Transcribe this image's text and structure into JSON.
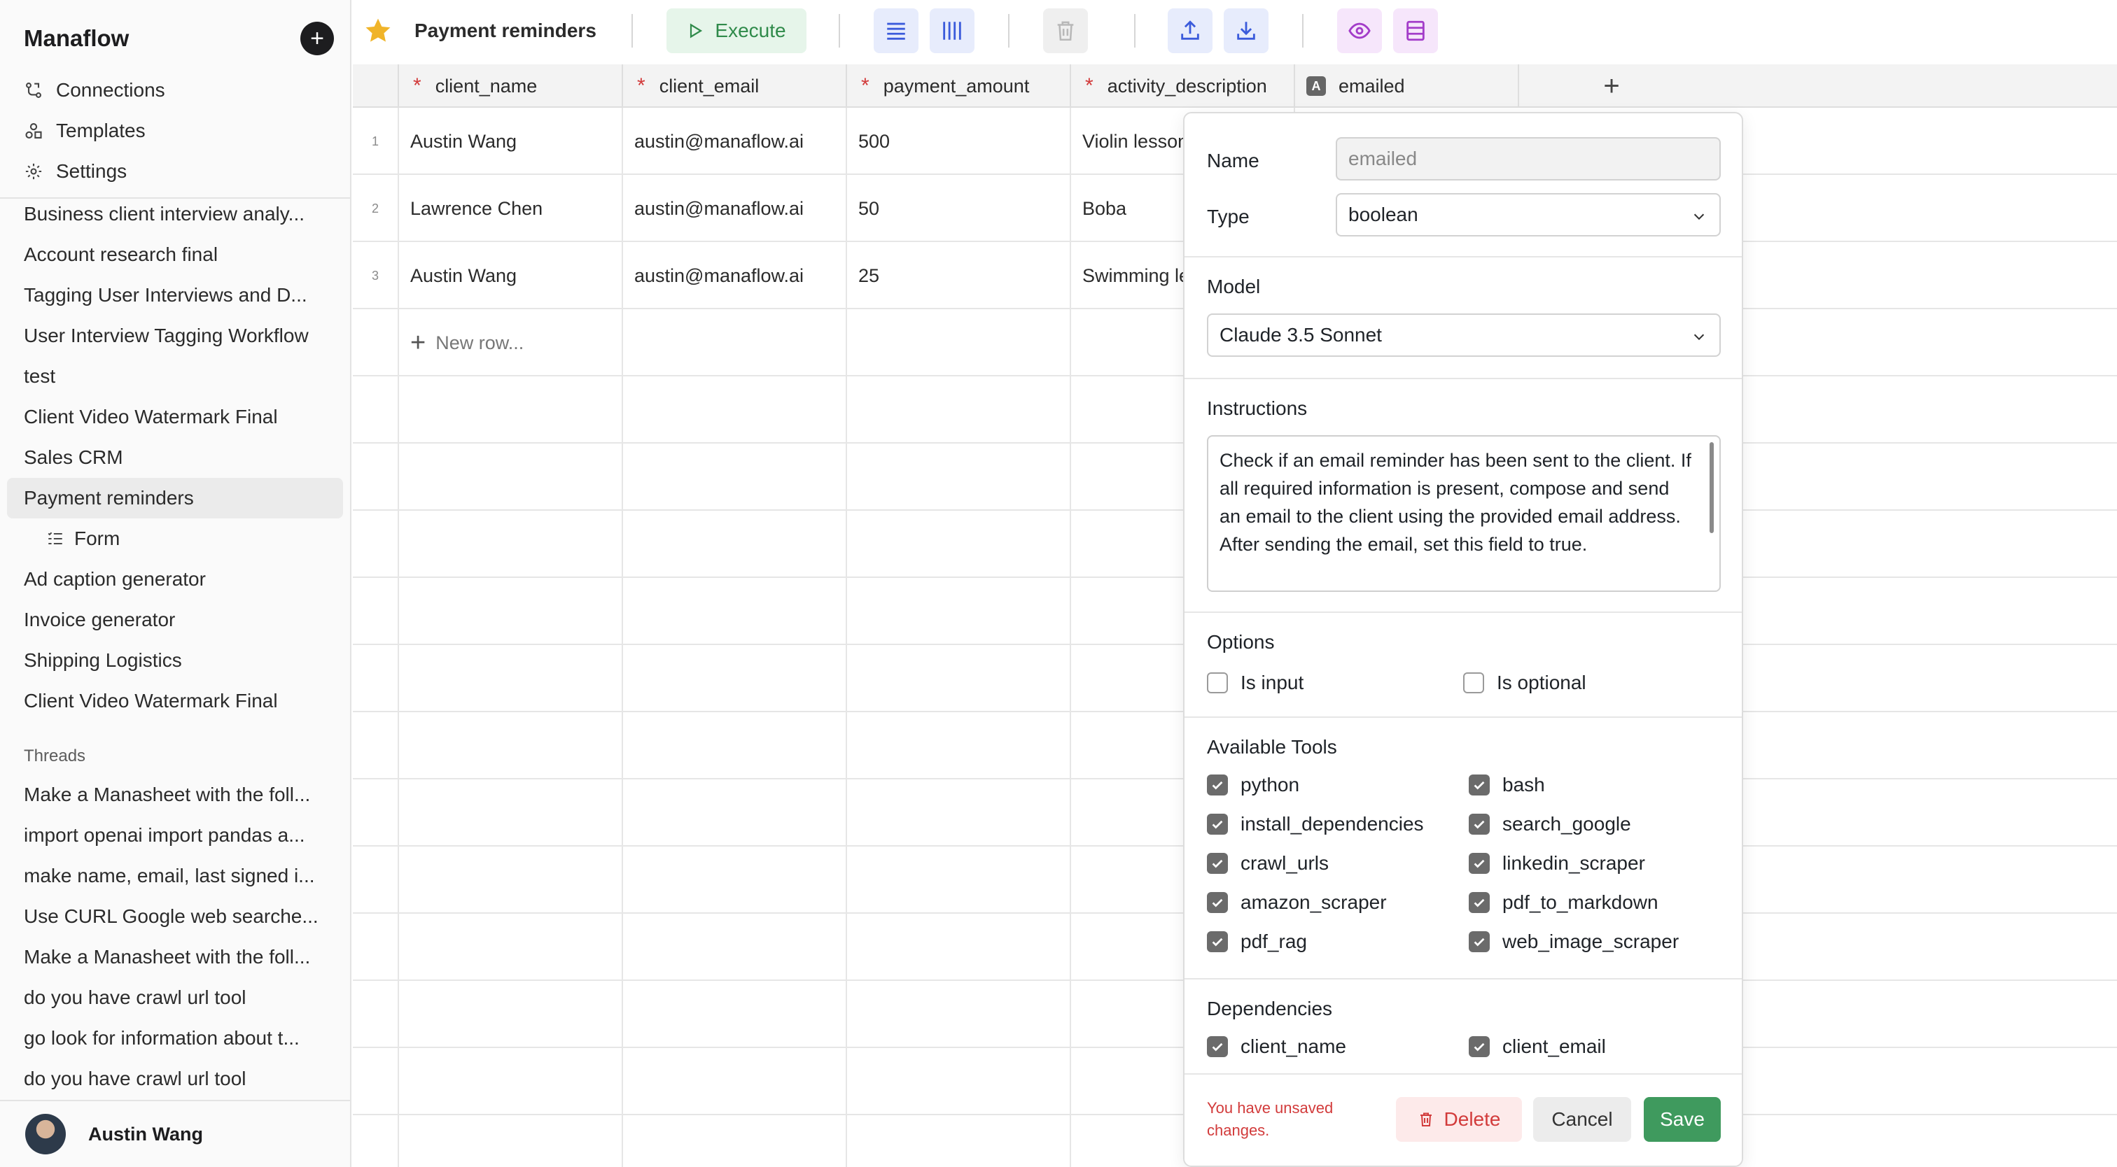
{
  "sidebar": {
    "brand": "Manaflow",
    "add_label": "+",
    "nav": [
      {
        "label": "Connections",
        "icon": "connections-icon"
      },
      {
        "label": "Templates",
        "icon": "templates-icon"
      },
      {
        "label": "Settings",
        "icon": "gear-icon"
      }
    ],
    "items": [
      "Business client interview analy...",
      "Account research final",
      "Tagging User Interviews and D...",
      "User Interview Tagging Workflow",
      "test",
      "Client Video Watermark Final",
      "Sales CRM",
      "Payment reminders",
      "Form",
      "Ad caption generator",
      "Invoice generator",
      "Shipping Logistics",
      "Client Video Watermark Final"
    ],
    "threads_title": "Threads",
    "threads": [
      "Make a Manasheet with the foll...",
      "import openai import pandas a...",
      "make name, email, last signed i...",
      "Use CURL Google web searche...",
      "Make a Manasheet with the foll...",
      "do you have crawl url tool",
      "go look for information about t...",
      "do you have crawl url tool"
    ],
    "user_name": "Austin Wang"
  },
  "toolbar": {
    "title": "Payment reminders",
    "execute_label": "Execute"
  },
  "grid": {
    "columns": [
      {
        "label": "client_name",
        "required": "*"
      },
      {
        "label": "client_email",
        "required": "*"
      },
      {
        "label": "payment_amount",
        "required": "*"
      },
      {
        "label": "activity_description",
        "required": "*"
      },
      {
        "label": "emailed",
        "type_badge": "A"
      }
    ],
    "add_column_label": "+",
    "rows": [
      {
        "num": "1",
        "client_name": "Austin Wang",
        "client_email": "austin@manaflow.ai",
        "payment_amount": "500",
        "activity_description": "Violin lessons"
      },
      {
        "num": "2",
        "client_name": "Lawrence Chen",
        "client_email": "austin@manaflow.ai",
        "payment_amount": "50",
        "activity_description": "Boba"
      },
      {
        "num": "3",
        "client_name": "Austin Wang",
        "client_email": "austin@manaflow.ai",
        "payment_amount": "25",
        "activity_description": "Swimming lessons"
      }
    ],
    "new_row_label": "New row..."
  },
  "panel": {
    "name_label": "Name",
    "name_placeholder": "emailed",
    "type_label": "Type",
    "type_value": "boolean",
    "model_label": "Model",
    "model_value": "Claude 3.5 Sonnet",
    "instructions_label": "Instructions",
    "instructions": "Check if an email reminder has been sent to the client. If all required information is present, compose and send an email to the client using the provided email address. After sending the email, set this field to true.",
    "options_label": "Options",
    "options": [
      {
        "label": "Is input",
        "checked": false
      },
      {
        "label": "Is optional",
        "checked": false
      }
    ],
    "tools_label": "Available Tools",
    "tools": [
      {
        "label": "python",
        "checked": true
      },
      {
        "label": "bash",
        "checked": true
      },
      {
        "label": "install_dependencies",
        "checked": true
      },
      {
        "label": "search_google",
        "checked": true
      },
      {
        "label": "crawl_urls",
        "checked": true
      },
      {
        "label": "linkedin_scraper",
        "checked": true
      },
      {
        "label": "amazon_scraper",
        "checked": true
      },
      {
        "label": "pdf_to_markdown",
        "checked": true
      },
      {
        "label": "pdf_rag",
        "checked": true
      },
      {
        "label": "web_image_scraper",
        "checked": true
      }
    ],
    "dependencies_label": "Dependencies",
    "dependencies": [
      {
        "label": "client_name",
        "checked": true
      },
      {
        "label": "client_email",
        "checked": true
      }
    ],
    "unsaved_text": "You have unsaved changes.",
    "delete_label": "Delete",
    "cancel_label": "Cancel",
    "save_label": "Save"
  },
  "colors": {
    "accent_green": "#3f9a5e",
    "danger_red": "#d23b3b",
    "star_gold": "#f0b429",
    "blue_icon": "#3b5bdb",
    "purple_icon": "#a33cc9"
  }
}
